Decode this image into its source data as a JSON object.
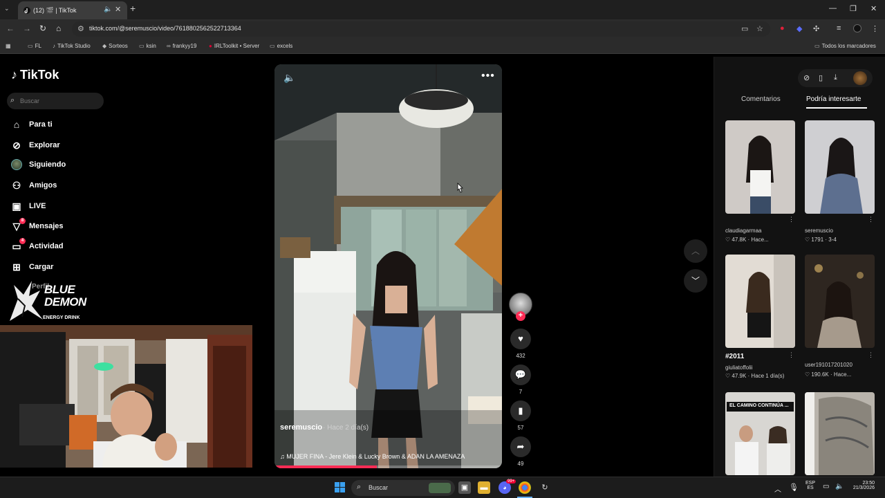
{
  "browser": {
    "tab_title": "(12) 🎬 | TikTok",
    "url": "tiktok.com/@seremuscio/video/7618802562522713364",
    "bookmarks": [
      "FL",
      "TikTok Studio",
      "Sorteos",
      "ksin",
      "frankyy19",
      "IRLToolkit • Server",
      "excels"
    ],
    "all_bookmarks": "Todos los marcadores"
  },
  "sidebar": {
    "logo": "TikTok",
    "search_placeholder": "Buscar",
    "items": [
      {
        "label": "Para ti",
        "icon": "home-icon"
      },
      {
        "label": "Explorar",
        "icon": "compass-icon"
      },
      {
        "label": "Siguiendo",
        "icon": "following-avatar-icon"
      },
      {
        "label": "Amigos",
        "icon": "friends-icon"
      },
      {
        "label": "LIVE",
        "icon": "live-icon"
      },
      {
        "label": "Mensajes",
        "icon": "messages-icon",
        "badge": "8"
      },
      {
        "label": "Actividad",
        "icon": "activity-icon",
        "badge": "4"
      },
      {
        "label": "Cargar",
        "icon": "upload-icon"
      }
    ],
    "partial_label": "Perfil"
  },
  "overlay": {
    "brand_line1": "BLUE",
    "brand_line2": "DEMON",
    "brand_sub": "ENERGY DRINK"
  },
  "video": {
    "author": "seremuscio",
    "time": "· Hace 2 día(s)",
    "music": "MUJER FINA - Jere Klein & Lucky Brown & ADAN LA AMENAZA",
    "progress": 0.45
  },
  "actions": {
    "likes": "432",
    "comments": "7",
    "saves": "57",
    "shares": "49"
  },
  "right_panel": {
    "tabs": [
      "Comentarios",
      "Podría interesarte"
    ],
    "active_tab": 1,
    "items": [
      {
        "user": "claudiagarmaa",
        "meta": "♡ 47.8K · Hace..."
      },
      {
        "user": "seremuscio",
        "meta": "♡ 1791 · 3-4"
      },
      {
        "title": "#2011",
        "user": "giuliatoffolii",
        "meta": "♡ 47.9K · Hace 1 día(s)"
      },
      {
        "user": "user191017201020",
        "meta": "♡ 190.6K · Hace..."
      },
      {
        "caption": "EL CAMINO CONTINÚA ..."
      },
      {}
    ]
  },
  "taskbar": {
    "search": "Buscar",
    "lang_top": "ESP",
    "lang_bottom": "ES",
    "time": "23:50",
    "date": "21/3/2026",
    "discord_badge": "99+"
  },
  "colors": {
    "accent": "#fe2c55",
    "background": "#000000",
    "panel": "#121212"
  }
}
